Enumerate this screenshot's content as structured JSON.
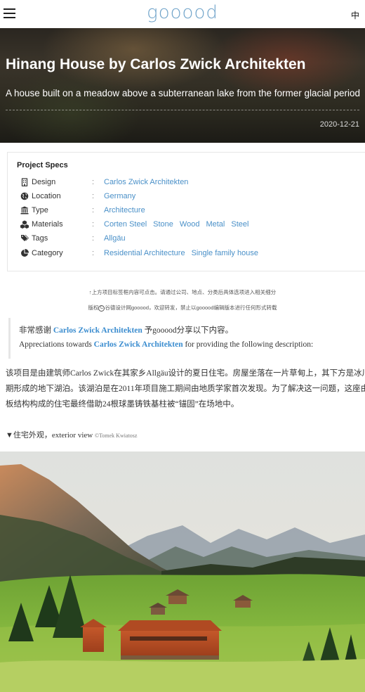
{
  "header": {
    "logo_text": "gooood",
    "lang_label": "中",
    "menu_icon": "hamburger-menu-icon"
  },
  "hero": {
    "title": "Hinang House by Carlos Zwick Architekten",
    "subtitle": "A house built on a meadow above a subterranean lake from the former glacial period",
    "date": "2020-12-21"
  },
  "specs": {
    "title": "Project Specs",
    "rows": [
      {
        "icon": "building-icon",
        "label": "Design",
        "values": [
          "Carlos Zwick Architekten"
        ]
      },
      {
        "icon": "globe-icon",
        "label": "Location",
        "values": [
          "Germany"
        ]
      },
      {
        "icon": "institution-icon",
        "label": "Type",
        "values": [
          "Architecture"
        ]
      },
      {
        "icon": "cubes-icon",
        "label": "Materials",
        "values": [
          "Corten Steel",
          "Stone",
          "Wood",
          "Metal",
          "Steel"
        ]
      },
      {
        "icon": "tags-icon",
        "label": "Tags",
        "values": [
          "Allgäu"
        ]
      },
      {
        "icon": "pie-chart-icon",
        "label": "Category",
        "values": [
          "Residential Architecture",
          "Single family house"
        ]
      }
    ],
    "colon": ":"
  },
  "notice": {
    "line1": "↑上方项目标签框内容可点击。请通过公司、地点、分类后具体选项进入相关细分",
    "line2_prefix": "版权",
    "line2_copyright_symbol": "C",
    "line2_suffix": "谷德设计网gooood，欢迎转发，禁止以gooood编辑版本进行任何形式转载"
  },
  "thanks": {
    "cn_prefix": "非常感谢 ",
    "cn_link": "Carlos Zwick Architekten",
    "cn_suffix": " 予gooood分享以下内容。",
    "en_prefix": "Appreciations towards ",
    "en_link": "Carlos Zwick Architekten",
    "en_suffix": " for providing the following description:"
  },
  "body": {
    "lines": [
      "该项目是由建筑师Carlos Zwick在其家乡Allgäu设计的夏日住宅。房屋坐落在一片草甸上，其下方是冰川时",
      "期形成的地下湖泊。该湖泊是在2011年项目施工期间由地质学家首次发现。为了解决这一问题，这座由模",
      "板结构构成的住宅最终借助24根球墨铸铁基柱被“锚固”在场地中。"
    ]
  },
  "caption": {
    "text": "▼住宅外观，exterior view ",
    "credit": "©Tomek Kwiatosz"
  },
  "colors": {
    "link": "#4a90c8",
    "logo": "#6fa3c9",
    "thanks_link": "#3a8ccf"
  }
}
